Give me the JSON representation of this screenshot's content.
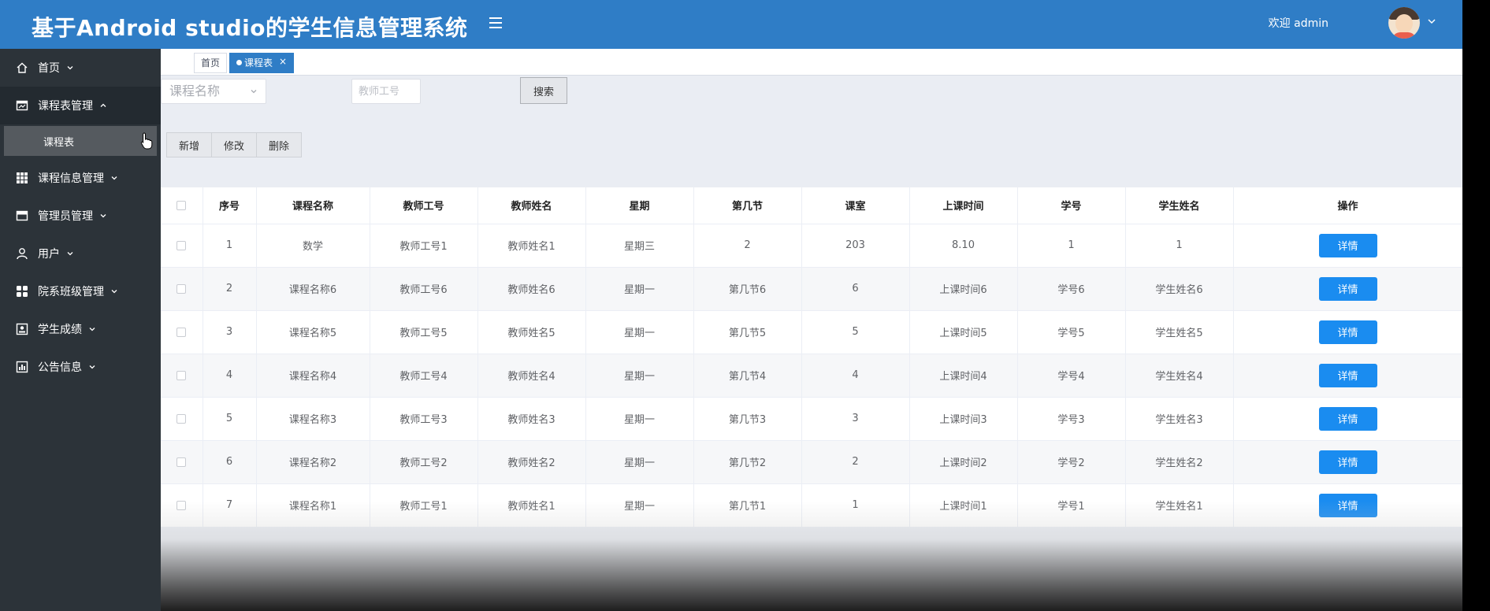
{
  "header": {
    "title": "基于Android studio的学生信息管理系统",
    "welcome": "欢迎 admin",
    "colors": {
      "primary": "#2f7dc6",
      "sidebar": "#2c3339",
      "detail_button": "#1a8cf0"
    }
  },
  "sidebar": {
    "items": [
      {
        "label": "首页",
        "icon": "home-icon"
      },
      {
        "label": "课程表管理",
        "icon": "calendar-icon",
        "open": true,
        "children": [
          {
            "label": "课程表"
          }
        ]
      },
      {
        "label": "课程信息管理",
        "icon": "grid-icon"
      },
      {
        "label": "管理员管理",
        "icon": "card-icon"
      },
      {
        "label": "用户",
        "icon": "user-icon"
      },
      {
        "label": "院系班级管理",
        "icon": "tiles-icon"
      },
      {
        "label": "学生成绩",
        "icon": "id-card-icon"
      },
      {
        "label": "公告信息",
        "icon": "bar-chart-icon"
      }
    ]
  },
  "tabs": {
    "home": "首页",
    "current": "课程表",
    "close": "×"
  },
  "search": {
    "select_placeholder": "课程名称",
    "input_placeholder": "教师工号",
    "button": "搜索"
  },
  "actions": {
    "add": "新增",
    "edit": "修改",
    "delete": "删除"
  },
  "table": {
    "columns": [
      "序号",
      "课程名称",
      "教师工号",
      "教师姓名",
      "星期",
      "第几节",
      "课室",
      "上课时间",
      "学号",
      "学生姓名",
      "操作"
    ],
    "detail_label": "详情",
    "rows": [
      [
        "1",
        "数学",
        "教师工号1",
        "教师姓名1",
        "星期三",
        "2",
        "203",
        "8.10",
        "1",
        "1"
      ],
      [
        "2",
        "课程名称6",
        "教师工号6",
        "教师姓名6",
        "星期一",
        "第几节6",
        "6",
        "上课时间6",
        "学号6",
        "学生姓名6"
      ],
      [
        "3",
        "课程名称5",
        "教师工号5",
        "教师姓名5",
        "星期一",
        "第几节5",
        "5",
        "上课时间5",
        "学号5",
        "学生姓名5"
      ],
      [
        "4",
        "课程名称4",
        "教师工号4",
        "教师姓名4",
        "星期一",
        "第几节4",
        "4",
        "上课时间4",
        "学号4",
        "学生姓名4"
      ],
      [
        "5",
        "课程名称3",
        "教师工号3",
        "教师姓名3",
        "星期一",
        "第几节3",
        "3",
        "上课时间3",
        "学号3",
        "学生姓名3"
      ],
      [
        "6",
        "课程名称2",
        "教师工号2",
        "教师姓名2",
        "星期一",
        "第几节2",
        "2",
        "上课时间2",
        "学号2",
        "学生姓名2"
      ],
      [
        "7",
        "课程名称1",
        "教师工号1",
        "教师姓名1",
        "星期一",
        "第几节1",
        "1",
        "上课时间1",
        "学号1",
        "学生姓名1"
      ]
    ]
  }
}
